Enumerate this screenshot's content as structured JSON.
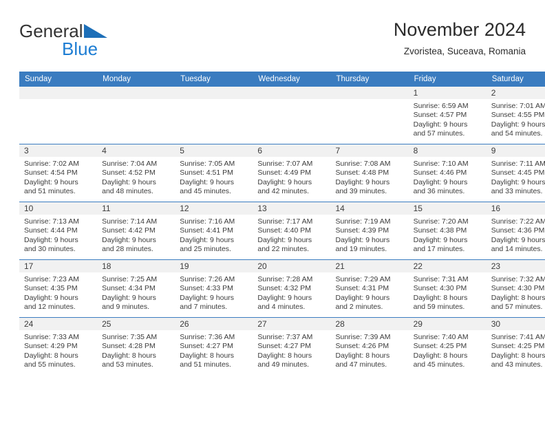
{
  "brand": {
    "name_top": "General",
    "name_bottom": "Blue",
    "mark": "triangle-logo-icon",
    "colors": {
      "text": "#333333",
      "blue": "#1d7dd3"
    }
  },
  "header": {
    "title": "November 2024",
    "subtitle": "Zvoristea, Suceava, Romania"
  },
  "calendar": {
    "accent_color": "#3a7cc0",
    "day_header_bg": "#f1f1f1",
    "weekday_headers": [
      "Sunday",
      "Monday",
      "Tuesday",
      "Wednesday",
      "Thursday",
      "Friday",
      "Saturday"
    ],
    "weeks": [
      [
        {
          "day": "",
          "sunrise": "",
          "sunset": "",
          "daylight_line1": "",
          "daylight_line2": ""
        },
        {
          "day": "",
          "sunrise": "",
          "sunset": "",
          "daylight_line1": "",
          "daylight_line2": ""
        },
        {
          "day": "",
          "sunrise": "",
          "sunset": "",
          "daylight_line1": "",
          "daylight_line2": ""
        },
        {
          "day": "",
          "sunrise": "",
          "sunset": "",
          "daylight_line1": "",
          "daylight_line2": ""
        },
        {
          "day": "",
          "sunrise": "",
          "sunset": "",
          "daylight_line1": "",
          "daylight_line2": ""
        },
        {
          "day": "1",
          "sunrise": "Sunrise: 6:59 AM",
          "sunset": "Sunset: 4:57 PM",
          "daylight_line1": "Daylight: 9 hours",
          "daylight_line2": "and 57 minutes."
        },
        {
          "day": "2",
          "sunrise": "Sunrise: 7:01 AM",
          "sunset": "Sunset: 4:55 PM",
          "daylight_line1": "Daylight: 9 hours",
          "daylight_line2": "and 54 minutes."
        }
      ],
      [
        {
          "day": "3",
          "sunrise": "Sunrise: 7:02 AM",
          "sunset": "Sunset: 4:54 PM",
          "daylight_line1": "Daylight: 9 hours",
          "daylight_line2": "and 51 minutes."
        },
        {
          "day": "4",
          "sunrise": "Sunrise: 7:04 AM",
          "sunset": "Sunset: 4:52 PM",
          "daylight_line1": "Daylight: 9 hours",
          "daylight_line2": "and 48 minutes."
        },
        {
          "day": "5",
          "sunrise": "Sunrise: 7:05 AM",
          "sunset": "Sunset: 4:51 PM",
          "daylight_line1": "Daylight: 9 hours",
          "daylight_line2": "and 45 minutes."
        },
        {
          "day": "6",
          "sunrise": "Sunrise: 7:07 AM",
          "sunset": "Sunset: 4:49 PM",
          "daylight_line1": "Daylight: 9 hours",
          "daylight_line2": "and 42 minutes."
        },
        {
          "day": "7",
          "sunrise": "Sunrise: 7:08 AM",
          "sunset": "Sunset: 4:48 PM",
          "daylight_line1": "Daylight: 9 hours",
          "daylight_line2": "and 39 minutes."
        },
        {
          "day": "8",
          "sunrise": "Sunrise: 7:10 AM",
          "sunset": "Sunset: 4:46 PM",
          "daylight_line1": "Daylight: 9 hours",
          "daylight_line2": "and 36 minutes."
        },
        {
          "day": "9",
          "sunrise": "Sunrise: 7:11 AM",
          "sunset": "Sunset: 4:45 PM",
          "daylight_line1": "Daylight: 9 hours",
          "daylight_line2": "and 33 minutes."
        }
      ],
      [
        {
          "day": "10",
          "sunrise": "Sunrise: 7:13 AM",
          "sunset": "Sunset: 4:44 PM",
          "daylight_line1": "Daylight: 9 hours",
          "daylight_line2": "and 30 minutes."
        },
        {
          "day": "11",
          "sunrise": "Sunrise: 7:14 AM",
          "sunset": "Sunset: 4:42 PM",
          "daylight_line1": "Daylight: 9 hours",
          "daylight_line2": "and 28 minutes."
        },
        {
          "day": "12",
          "sunrise": "Sunrise: 7:16 AM",
          "sunset": "Sunset: 4:41 PM",
          "daylight_line1": "Daylight: 9 hours",
          "daylight_line2": "and 25 minutes."
        },
        {
          "day": "13",
          "sunrise": "Sunrise: 7:17 AM",
          "sunset": "Sunset: 4:40 PM",
          "daylight_line1": "Daylight: 9 hours",
          "daylight_line2": "and 22 minutes."
        },
        {
          "day": "14",
          "sunrise": "Sunrise: 7:19 AM",
          "sunset": "Sunset: 4:39 PM",
          "daylight_line1": "Daylight: 9 hours",
          "daylight_line2": "and 19 minutes."
        },
        {
          "day": "15",
          "sunrise": "Sunrise: 7:20 AM",
          "sunset": "Sunset: 4:38 PM",
          "daylight_line1": "Daylight: 9 hours",
          "daylight_line2": "and 17 minutes."
        },
        {
          "day": "16",
          "sunrise": "Sunrise: 7:22 AM",
          "sunset": "Sunset: 4:36 PM",
          "daylight_line1": "Daylight: 9 hours",
          "daylight_line2": "and 14 minutes."
        }
      ],
      [
        {
          "day": "17",
          "sunrise": "Sunrise: 7:23 AM",
          "sunset": "Sunset: 4:35 PM",
          "daylight_line1": "Daylight: 9 hours",
          "daylight_line2": "and 12 minutes."
        },
        {
          "day": "18",
          "sunrise": "Sunrise: 7:25 AM",
          "sunset": "Sunset: 4:34 PM",
          "daylight_line1": "Daylight: 9 hours",
          "daylight_line2": "and 9 minutes."
        },
        {
          "day": "19",
          "sunrise": "Sunrise: 7:26 AM",
          "sunset": "Sunset: 4:33 PM",
          "daylight_line1": "Daylight: 9 hours",
          "daylight_line2": "and 7 minutes."
        },
        {
          "day": "20",
          "sunrise": "Sunrise: 7:28 AM",
          "sunset": "Sunset: 4:32 PM",
          "daylight_line1": "Daylight: 9 hours",
          "daylight_line2": "and 4 minutes."
        },
        {
          "day": "21",
          "sunrise": "Sunrise: 7:29 AM",
          "sunset": "Sunset: 4:31 PM",
          "daylight_line1": "Daylight: 9 hours",
          "daylight_line2": "and 2 minutes."
        },
        {
          "day": "22",
          "sunrise": "Sunrise: 7:31 AM",
          "sunset": "Sunset: 4:30 PM",
          "daylight_line1": "Daylight: 8 hours",
          "daylight_line2": "and 59 minutes."
        },
        {
          "day": "23",
          "sunrise": "Sunrise: 7:32 AM",
          "sunset": "Sunset: 4:30 PM",
          "daylight_line1": "Daylight: 8 hours",
          "daylight_line2": "and 57 minutes."
        }
      ],
      [
        {
          "day": "24",
          "sunrise": "Sunrise: 7:33 AM",
          "sunset": "Sunset: 4:29 PM",
          "daylight_line1": "Daylight: 8 hours",
          "daylight_line2": "and 55 minutes."
        },
        {
          "day": "25",
          "sunrise": "Sunrise: 7:35 AM",
          "sunset": "Sunset: 4:28 PM",
          "daylight_line1": "Daylight: 8 hours",
          "daylight_line2": "and 53 minutes."
        },
        {
          "day": "26",
          "sunrise": "Sunrise: 7:36 AM",
          "sunset": "Sunset: 4:27 PM",
          "daylight_line1": "Daylight: 8 hours",
          "daylight_line2": "and 51 minutes."
        },
        {
          "day": "27",
          "sunrise": "Sunrise: 7:37 AM",
          "sunset": "Sunset: 4:27 PM",
          "daylight_line1": "Daylight: 8 hours",
          "daylight_line2": "and 49 minutes."
        },
        {
          "day": "28",
          "sunrise": "Sunrise: 7:39 AM",
          "sunset": "Sunset: 4:26 PM",
          "daylight_line1": "Daylight: 8 hours",
          "daylight_line2": "and 47 minutes."
        },
        {
          "day": "29",
          "sunrise": "Sunrise: 7:40 AM",
          "sunset": "Sunset: 4:25 PM",
          "daylight_line1": "Daylight: 8 hours",
          "daylight_line2": "and 45 minutes."
        },
        {
          "day": "30",
          "sunrise": "Sunrise: 7:41 AM",
          "sunset": "Sunset: 4:25 PM",
          "daylight_line1": "Daylight: 8 hours",
          "daylight_line2": "and 43 minutes."
        }
      ]
    ]
  }
}
